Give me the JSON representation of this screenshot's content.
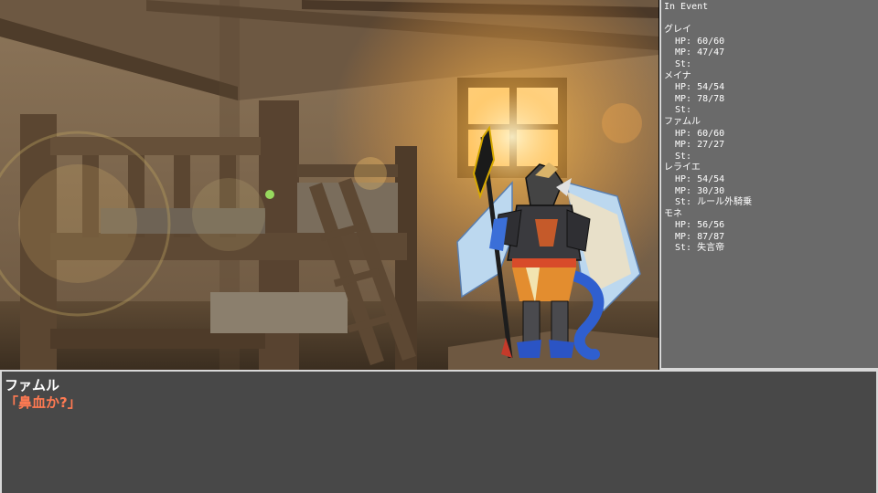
{
  "status_panel": {
    "header": "In Event",
    "party": [
      {
        "name": "グレイ",
        "hp": "HP: 60/60",
        "mp": "MP: 47/47",
        "st": "St:"
      },
      {
        "name": "メイナ",
        "hp": "HP: 54/54",
        "mp": "MP: 78/78",
        "st": "St:"
      },
      {
        "name": "ファムル",
        "hp": "HP: 60/60",
        "mp": "MP: 27/27",
        "st": "St:"
      },
      {
        "name": "レライエ",
        "hp": "HP: 54/54",
        "mp": "MP: 30/30",
        "st": "St: ルール外騎乗"
      },
      {
        "name": "モネ",
        "hp": "HP: 56/56",
        "mp": "MP: 87/87",
        "st": "St: 失言帝"
      }
    ]
  },
  "message": {
    "speaker": "ファムル",
    "text": "「鼻血か?」"
  },
  "colors": {
    "message_text": "#ff7a52",
    "panel_bg": "#6a6a6a",
    "window_bg": "#484848"
  }
}
